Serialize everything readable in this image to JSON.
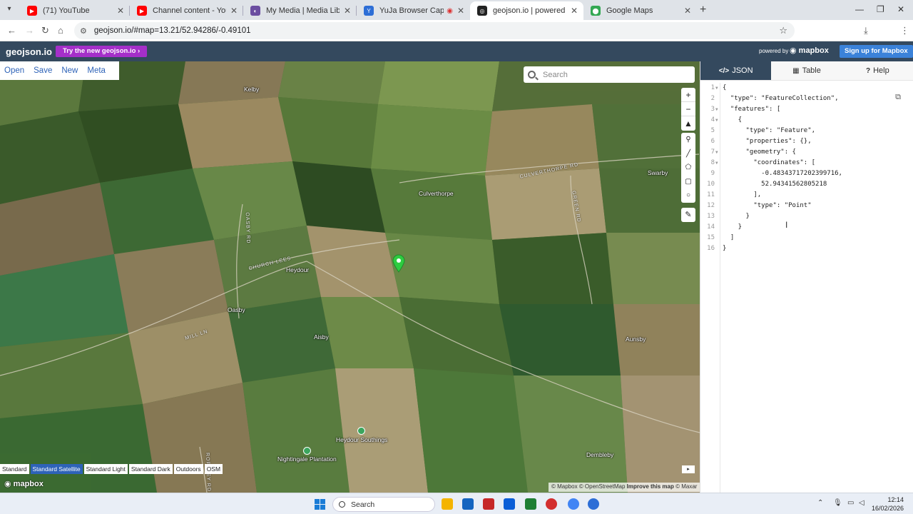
{
  "browser": {
    "tabs": [
      {
        "title": "(71) YouTube",
        "icon": "youtube-icon",
        "color": "#ff0000"
      },
      {
        "title": "Channel content - YouTube Stu",
        "icon": "youtube-studio-icon",
        "color": "#ff0000"
      },
      {
        "title": "My Media | Media Library | Uni",
        "icon": "media-icon",
        "color": "#6b4ea1"
      },
      {
        "title": "YuJa Browser Capture Studi",
        "icon": "yuja-icon",
        "color": "#2d6ed6"
      },
      {
        "title": "geojson.io | powered by Mapb",
        "icon": "geojson-icon",
        "color": "#222222"
      },
      {
        "title": "Google Maps",
        "icon": "google-maps-icon",
        "color": "#34a853"
      }
    ],
    "url": "geojson.io/#map=13.21/52.94286/-0.49101"
  },
  "app": {
    "brand": "geojson.io",
    "try_label": "Try the new geojson.io",
    "powered_by": "powered by",
    "mapbox": "mapbox",
    "signup_label": "Sign up for Mapbox",
    "menu": [
      "Open",
      "Save",
      "New",
      "Meta"
    ]
  },
  "map": {
    "search_placeholder": "Search",
    "places": [
      {
        "name": "Kelby"
      },
      {
        "name": "Culverthorpe"
      },
      {
        "name": "Swarby"
      },
      {
        "name": "Heydour"
      },
      {
        "name": "Oasby"
      },
      {
        "name": "Aisby"
      },
      {
        "name": "Aunsby"
      },
      {
        "name": "Heydour Southings"
      },
      {
        "name": "Nightingale Plantation"
      },
      {
        "name": "Dembleby"
      }
    ],
    "roads": [
      "CULVERTHORPE RD",
      "CHURCH LEES",
      "MILL LN",
      "OASBY RD",
      "GREEN RD",
      "ROPSLEY RD"
    ],
    "styles": [
      "Standard",
      "Standard Satellite",
      "Standard Light",
      "Standard Dark",
      "Outdoors",
      "OSM"
    ],
    "active_style": "Standard Satellite",
    "logo": "mapbox",
    "attribution": {
      "mapbox": "© Mapbox",
      "osm": "© OpenStreetMap",
      "improve": "Improve this map",
      "maxar": "© Maxar"
    }
  },
  "panel": {
    "tabs": [
      {
        "label": "JSON",
        "icon": "</>"
      },
      {
        "label": "Table",
        "icon": "▦"
      },
      {
        "label": "Help",
        "icon": "?"
      }
    ],
    "lines": [
      "{",
      "  \"type\": \"FeatureCollection\",",
      "  \"features\": [",
      "    {",
      "      \"type\": \"Feature\",",
      "      \"properties\": {},",
      "      \"geometry\": {",
      "        \"coordinates\": [",
      "          -0.48343717202399716,",
      "          52.94341562805218",
      "        ],",
      "        \"type\": \"Point\"",
      "      }",
      "    }",
      "  ]",
      "}"
    ]
  },
  "taskbar": {
    "search": "Search",
    "time": "12:14",
    "date": "16/02/2026"
  },
  "colors": {
    "appbar": "#34495e",
    "try": "#a52fc9",
    "signup": "#3b82d9",
    "marker": "#2ecc40"
  }
}
